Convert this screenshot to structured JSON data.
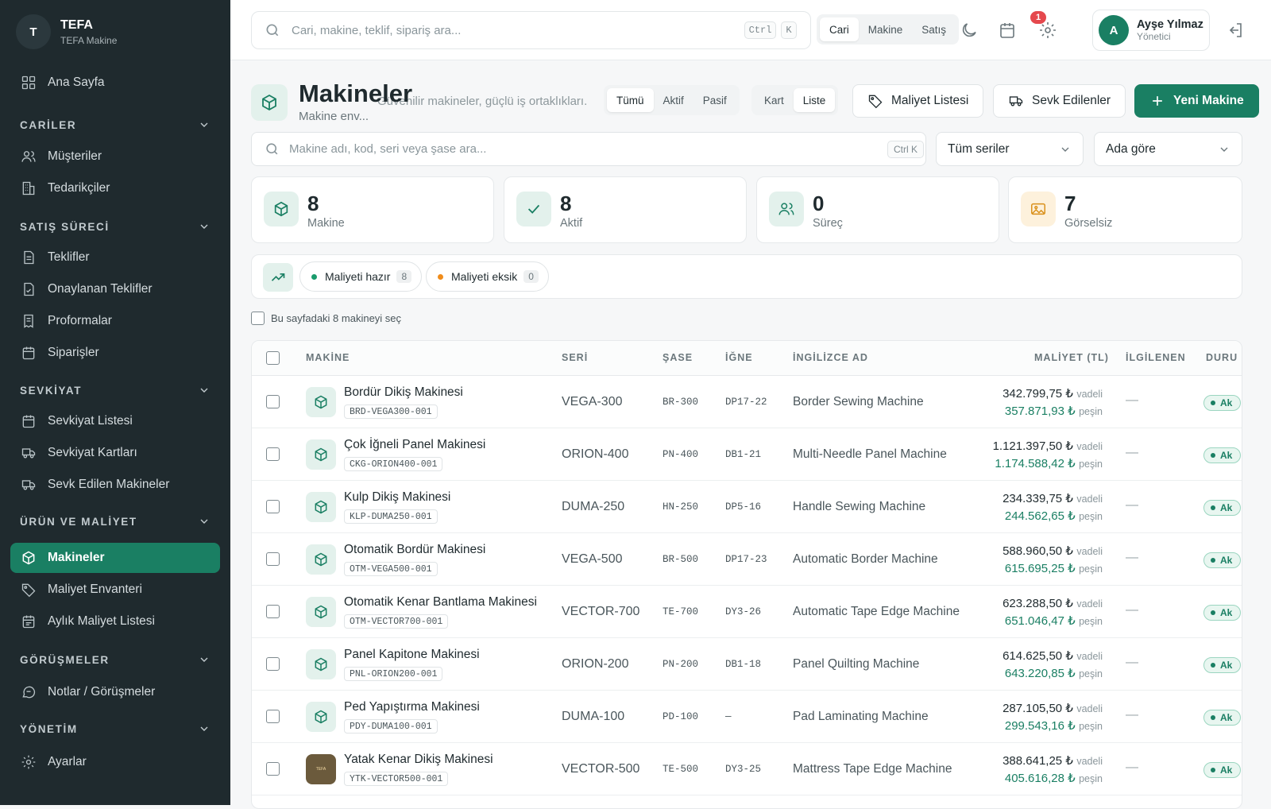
{
  "brand": {
    "initial": "T",
    "name": "TEFA",
    "subtitle": "TEFA Makine"
  },
  "sidebar": {
    "home": "Ana Sayfa",
    "sections": [
      {
        "title": "CARİLER",
        "items": [
          "Müşteriler",
          "Tedarikçiler"
        ]
      },
      {
        "title": "SATIŞ SÜRECİ",
        "items": [
          "Teklifler",
          "Onaylanan Teklifler",
          "Proformalar",
          "Siparişler"
        ]
      },
      {
        "title": "SEVKİYAT",
        "items": [
          "Sevkiyat Listesi",
          "Sevkiyat Kartları",
          "Sevk Edilen Makineler"
        ]
      },
      {
        "title": "ÜRÜN VE MALİYET",
        "items": [
          "Makineler",
          "Maliyet Envanteri",
          "Aylık Maliyet Listesi"
        ]
      },
      {
        "title": "GÖRÜŞMELER",
        "items": [
          "Notlar / Görüşmeler"
        ]
      },
      {
        "title": "YÖNETİM",
        "items": [
          "Ayarlar"
        ]
      }
    ]
  },
  "topbar": {
    "search_placeholder": "Cari, makine, teklif, sipariş ara...",
    "kbd_ctrl": "Ctrl",
    "kbd_k": "K",
    "scopes": [
      "Cari",
      "Makine",
      "Satış"
    ],
    "notif_count": "1",
    "user": {
      "initial": "A",
      "name": "Ayşe Yılmaz",
      "role": "Yönetici"
    }
  },
  "page": {
    "title": "Makineler",
    "subtitle": "Makine env...",
    "tagline": "Güvenilir makineler, güçlü iş ortaklıkları.",
    "status_filter": [
      "Tümü",
      "Aktif",
      "Pasif"
    ],
    "view_mode": [
      "Kart",
      "Liste"
    ],
    "btn_cost_list": "Maliyet Listesi",
    "btn_shipped": "Sevk Edilenler",
    "btn_new": "Yeni Makine",
    "search_placeholder": "Makine adı, kod, seri veya şase ara...",
    "search_kbd": "Ctrl K",
    "series_select": "Tüm seriler",
    "sort_select": "Ada göre"
  },
  "stats": [
    {
      "value": "8",
      "label": "Makine",
      "bg": "#e3f1ec",
      "color": "#1a7f63"
    },
    {
      "value": "8",
      "label": "Aktif",
      "bg": "#e3f1ec",
      "color": "#1a7f63"
    },
    {
      "value": "0",
      "label": "Süreç",
      "bg": "#e3f1ec",
      "color": "#1a7f63"
    },
    {
      "value": "7",
      "label": "Görselsiz",
      "bg": "#fdf1dc",
      "color": "#d9901a"
    }
  ],
  "cost_chips": [
    {
      "label": "Maliyeti hazır",
      "count": "8",
      "color": "#1a9b6c"
    },
    {
      "label": "Maliyeti eksik",
      "count": "0",
      "color": "#f08c1a"
    }
  ],
  "select_all": "Bu sayfadaki 8 makineyi seç",
  "table": {
    "columns": [
      "MAKİNE",
      "SERİ",
      "ŞASE",
      "İĞNE",
      "İNGİLİZCE AD",
      "MALİYET (TL)",
      "İLGİLENEN",
      "DURU"
    ],
    "vadeli": "vadeli",
    "pesin": "peşin",
    "rows": [
      {
        "name": "Bordür Dikiş Makinesi",
        "code": "BRD-VEGA300-001",
        "seri": "VEGA-300",
        "sase": "BR-300",
        "igne": "DP17-22",
        "eng": "Border Sewing Machine",
        "cost_v": "342.799,75 ₺",
        "cost_p": "357.871,93 ₺",
        "ilgilenen": "—",
        "durum": "Ak",
        "photo": false
      },
      {
        "name": "Çok İğneli Panel Makinesi",
        "code": "CKG-ORION400-001",
        "seri": "ORION-400",
        "sase": "PN-400",
        "igne": "DB1-21",
        "eng": "Multi-Needle Panel Machine",
        "cost_v": "1.121.397,50 ₺",
        "cost_p": "1.174.588,42 ₺",
        "ilgilenen": "—",
        "durum": "Ak",
        "photo": false
      },
      {
        "name": "Kulp Dikiş Makinesi",
        "code": "KLP-DUMA250-001",
        "seri": "DUMA-250",
        "sase": "HN-250",
        "igne": "DP5-16",
        "eng": "Handle Sewing Machine",
        "cost_v": "234.339,75 ₺",
        "cost_p": "244.562,65 ₺",
        "ilgilenen": "—",
        "durum": "Ak",
        "photo": false
      },
      {
        "name": "Otomatik Bordür Makinesi",
        "code": "OTM-VEGA500-001",
        "seri": "VEGA-500",
        "sase": "BR-500",
        "igne": "DP17-23",
        "eng": "Automatic Border Machine",
        "cost_v": "588.960,50 ₺",
        "cost_p": "615.695,25 ₺",
        "ilgilenen": "—",
        "durum": "Ak",
        "photo": false
      },
      {
        "name": "Otomatik Kenar Bantlama Makinesi",
        "code": "OTM-VECTOR700-001",
        "seri": "VECTOR-700",
        "sase": "TE-700",
        "igne": "DY3-26",
        "eng": "Automatic Tape Edge Machine",
        "cost_v": "623.288,50 ₺",
        "cost_p": "651.046,47 ₺",
        "ilgilenen": "—",
        "durum": "Ak",
        "photo": false
      },
      {
        "name": "Panel Kapitone Makinesi",
        "code": "PNL-ORION200-001",
        "seri": "ORION-200",
        "sase": "PN-200",
        "igne": "DB1-18",
        "eng": "Panel Quilting Machine",
        "cost_v": "614.625,50 ₺",
        "cost_p": "643.220,85 ₺",
        "ilgilenen": "—",
        "durum": "Ak",
        "photo": false
      },
      {
        "name": "Ped Yapıştırma Makinesi",
        "code": "PDY-DUMA100-001",
        "seri": "DUMA-100",
        "sase": "PD-100",
        "igne": "—",
        "eng": "Pad Laminating Machine",
        "cost_v": "287.105,50 ₺",
        "cost_p": "299.543,16 ₺",
        "ilgilenen": "—",
        "durum": "Ak",
        "photo": false
      },
      {
        "name": "Yatak Kenar Dikiş Makinesi",
        "code": "YTK-VECTOR500-001",
        "seri": "VECTOR-500",
        "sase": "TE-500",
        "igne": "DY3-25",
        "eng": "Mattress Tape Edge Machine",
        "cost_v": "388.641,25 ₺",
        "cost_p": "405.616,28 ₺",
        "ilgilenen": "—",
        "durum": "Ak",
        "photo": true
      }
    ]
  },
  "colors": {
    "accent": "#1a7f63",
    "sidebar_bg": "#1f2a2e",
    "danger": "#e5484d"
  }
}
